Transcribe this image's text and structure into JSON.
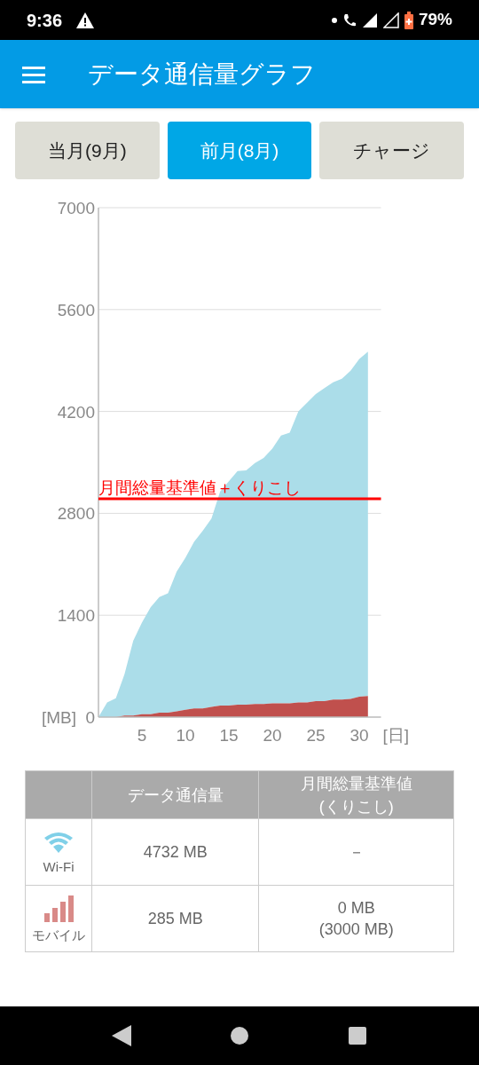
{
  "status_bar": {
    "time": "9:36",
    "battery": "79%"
  },
  "app_bar": {
    "title": "データ通信量グラフ"
  },
  "tabs": [
    {
      "label": "当月(9月)",
      "selected": false
    },
    {
      "label": "前月(8月)",
      "selected": true
    },
    {
      "label": "チャージ",
      "selected": false
    }
  ],
  "chart": {
    "chart_data": {
      "type": "area",
      "stacked": true,
      "xlabel": "[日]",
      "ylabel": "[MB]",
      "x": [
        0,
        1,
        2,
        3,
        4,
        5,
        6,
        7,
        8,
        9,
        10,
        11,
        12,
        13,
        14,
        15,
        16,
        17,
        18,
        19,
        20,
        21,
        22,
        23,
        24,
        25,
        26,
        27,
        28,
        29,
        30,
        31
      ],
      "xlim": [
        0,
        32.5
      ],
      "ylim": [
        0,
        7000
      ],
      "xticks": [
        5,
        10,
        15,
        20,
        25,
        30
      ],
      "yticks": [
        0,
        1400,
        2800,
        4200,
        5600,
        7000
      ],
      "series": [
        {
          "color": "#c0504d",
          "values": [
            0,
            0,
            0,
            20,
            20,
            40,
            40,
            60,
            60,
            80,
            100,
            120,
            120,
            140,
            160,
            160,
            170,
            170,
            180,
            180,
            190,
            190,
            190,
            200,
            200,
            220,
            220,
            240,
            240,
            250,
            280,
            290
          ]
        },
        {
          "color": "#abdde9",
          "values": [
            0,
            200,
            260,
            570,
            1030,
            1260,
            1470,
            1590,
            1640,
            1920,
            2090,
            2290,
            2440,
            2590,
            2940,
            3080,
            3210,
            3220,
            3310,
            3380,
            3500,
            3680,
            3720,
            4000,
            4120,
            4220,
            4300,
            4360,
            4410,
            4510,
            4640,
            4730
          ]
        }
      ],
      "grid": true,
      "ref_lines": [
        {
          "axis": "y",
          "value": 3000,
          "label": "月間総量基準値＋くりこし",
          "color": "#ff0000"
        }
      ]
    }
  },
  "table": {
    "columns": [
      "データ通信量",
      "月間総量基準値\n(くりこし)"
    ],
    "rows": [
      {
        "kind": "wifi",
        "label": "Wi-Fi",
        "usage": "4732 MB",
        "allowance": [
          "－"
        ]
      },
      {
        "kind": "mobile",
        "label": "モバイル",
        "usage": "285 MB",
        "allowance": [
          "0 MB",
          "(3000 MB)"
        ]
      }
    ]
  }
}
